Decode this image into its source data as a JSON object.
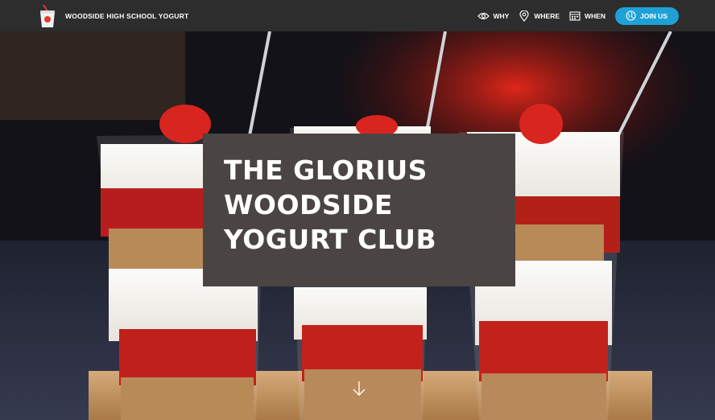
{
  "navbar": {
    "brand_name": "WOODSIDE HIGH SCHOOL YOGURT",
    "items": [
      {
        "label": "WHY",
        "icon": "eye-icon"
      },
      {
        "label": "WHERE",
        "icon": "map-pin-icon"
      },
      {
        "label": "WHEN",
        "icon": "calendar-icon"
      }
    ],
    "join_label": "JOIN US",
    "join_icon": "globe-icon"
  },
  "hero": {
    "title": "THE GLORIUS\nWOODSIDE\nYOGURT CLUB",
    "scroll_icon": "arrow-down-icon"
  },
  "colors": {
    "navbar_bg": "#2d2d2d",
    "accent": "#1ea2d6",
    "title_box_bg": "#4a4542"
  }
}
